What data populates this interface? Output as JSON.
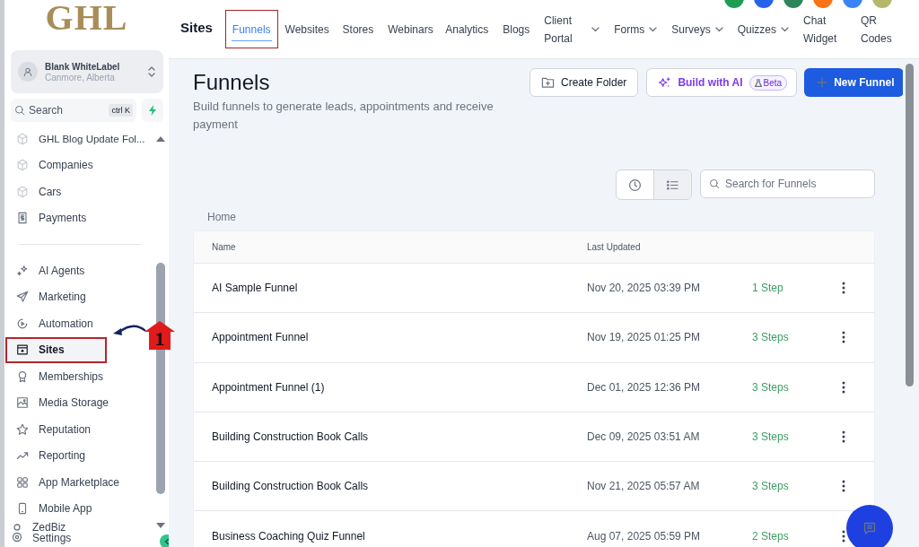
{
  "sidebar": {
    "logo": "GHL",
    "account": {
      "name": "Blank WhiteLabel",
      "location": "Canmore, Alberta"
    },
    "search": {
      "label": "Search",
      "shortcut": "ctrl K"
    },
    "groups": [
      {
        "items": [
          {
            "label": "GHL Blog Update Fol...",
            "selected": false,
            "highlighted": false
          },
          {
            "label": "Companies",
            "selected": false,
            "highlighted": false
          },
          {
            "label": "Cars",
            "selected": false,
            "highlighted": false
          },
          {
            "label": "Payments",
            "selected": false,
            "highlighted": false
          }
        ]
      },
      {
        "items": [
          {
            "label": "AI Agents",
            "selected": false,
            "highlighted": false
          },
          {
            "label": "Marketing",
            "selected": false,
            "highlighted": false
          },
          {
            "label": "Automation",
            "selected": false,
            "highlighted": false
          },
          {
            "label": "Sites",
            "selected": true,
            "highlighted": true
          },
          {
            "label": "Memberships",
            "selected": false,
            "highlighted": false
          },
          {
            "label": "Media Storage",
            "selected": false,
            "highlighted": false
          },
          {
            "label": "Reputation",
            "selected": false,
            "highlighted": false
          },
          {
            "label": "Reporting",
            "selected": false,
            "highlighted": false
          },
          {
            "label": "App Marketplace",
            "selected": false,
            "highlighted": false
          },
          {
            "label": "Mobile App",
            "selected": false,
            "highlighted": false
          }
        ]
      }
    ],
    "footer": {
      "org": "ZedBiz",
      "label": "Settings"
    }
  },
  "topnav": {
    "title": "Sites",
    "tabs": [
      {
        "label": "Funnels",
        "selected": true,
        "highlighted": true,
        "dropdown": false
      },
      {
        "label": "Websites",
        "selected": false,
        "highlighted": false,
        "dropdown": false
      },
      {
        "label": "Stores",
        "selected": false,
        "highlighted": false,
        "dropdown": false
      },
      {
        "label": "Webinars",
        "selected": false,
        "highlighted": false,
        "dropdown": false
      },
      {
        "label": "Analytics",
        "selected": false,
        "highlighted": false,
        "dropdown": false
      },
      {
        "label": "Blogs",
        "selected": false,
        "highlighted": false,
        "dropdown": false
      },
      {
        "label": "Client Portal",
        "selected": false,
        "highlighted": false,
        "dropdown": true
      },
      {
        "label": "Forms",
        "selected": false,
        "highlighted": false,
        "dropdown": true
      },
      {
        "label": "Surveys",
        "selected": false,
        "highlighted": false,
        "dropdown": true
      },
      {
        "label": "Quizzes",
        "selected": false,
        "highlighted": false,
        "dropdown": true
      },
      {
        "label": "Chat Widget",
        "selected": false,
        "highlighted": false,
        "dropdown": false
      },
      {
        "label": "QR Codes",
        "selected": false,
        "highlighted": false,
        "dropdown": false
      }
    ]
  },
  "page": {
    "title": "Funnels",
    "subtitle": "Build funnels to generate leads, appointments and receive payment",
    "buttons": [
      {
        "kind": "outline",
        "label": "Create Folder"
      },
      {
        "kind": "ai",
        "label": "Build with AI",
        "badge": "Beta"
      },
      {
        "kind": "primary",
        "label": "New Funnel"
      }
    ],
    "view_toggle": [
      {
        "kind": "recent",
        "selected": false
      },
      {
        "kind": "list",
        "selected": true
      }
    ],
    "search": {
      "placeholder": "Search for Funnels"
    },
    "breadcrumb": "Home",
    "table": {
      "columns": [
        "Name",
        "Last Updated"
      ],
      "rows": [
        {
          "name": "AI Sample Funnel",
          "updated": "Nov 20, 2025 03:39 PM",
          "steps": "1 Step"
        },
        {
          "name": "Appointment Funnel",
          "updated": "Nov 19, 2025 01:25 PM",
          "steps": "3 Steps"
        },
        {
          "name": "Appointment Funnel (1)",
          "updated": "Dec 01, 2025 12:36 PM",
          "steps": "3 Steps"
        },
        {
          "name": "Building Construction Book Calls",
          "updated": "Dec 09, 2025 03:51 AM",
          "steps": "3 Steps"
        },
        {
          "name": "Building Construction Book Calls",
          "updated": "Nov 21, 2025 05:57 AM",
          "steps": "3 Steps"
        },
        {
          "name": "Business Coaching Quiz Funnel",
          "updated": "Aug 07, 2025 05:59 PM",
          "steps": "2 Steps"
        }
      ]
    }
  },
  "annotation": {
    "marker": "1"
  }
}
